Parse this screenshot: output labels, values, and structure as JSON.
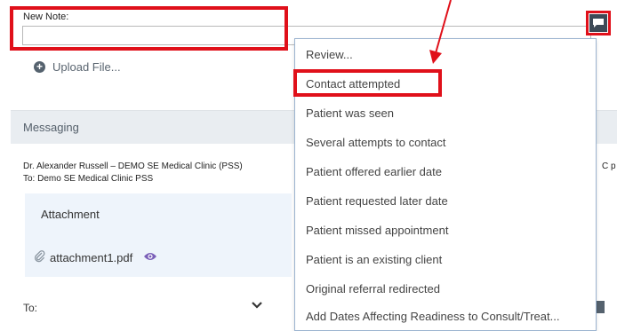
{
  "note": {
    "label": "New Note:",
    "value": "",
    "upload_label": "Upload File..."
  },
  "messaging": {
    "title": "Messaging",
    "from": "Dr. Alexander Russell – DEMO SE Medical Clinic (PSS)",
    "to": "To: Demo SE Medical Clinic PSS",
    "cut_text": "C p",
    "attachment_heading": "Attachment",
    "attachment_file": "attachment1.pdf",
    "to_label": "To:"
  },
  "dropdown": {
    "items": [
      "Review...",
      "Contact attempted",
      "Patient was seen",
      "Several attempts to contact",
      "Patient offered earlier date",
      "Patient requested later date",
      "Patient missed appointment",
      "Patient is an existing client",
      "Original referral redirected",
      "Add Dates Affecting Readiness to Consult/Treat..."
    ]
  },
  "icons": {
    "comment_button": "comment-icon",
    "upload": "plus-circle-icon",
    "attachment": "paperclip-icon",
    "preview": "eye-icon",
    "recipient_select": "chevron-down-icon"
  },
  "colors": {
    "annotation": "#e0101a",
    "messaging_bar": "#e9edf1",
    "attachment_bg": "#eef4fb",
    "dropdown_border": "#9cb4d0"
  }
}
